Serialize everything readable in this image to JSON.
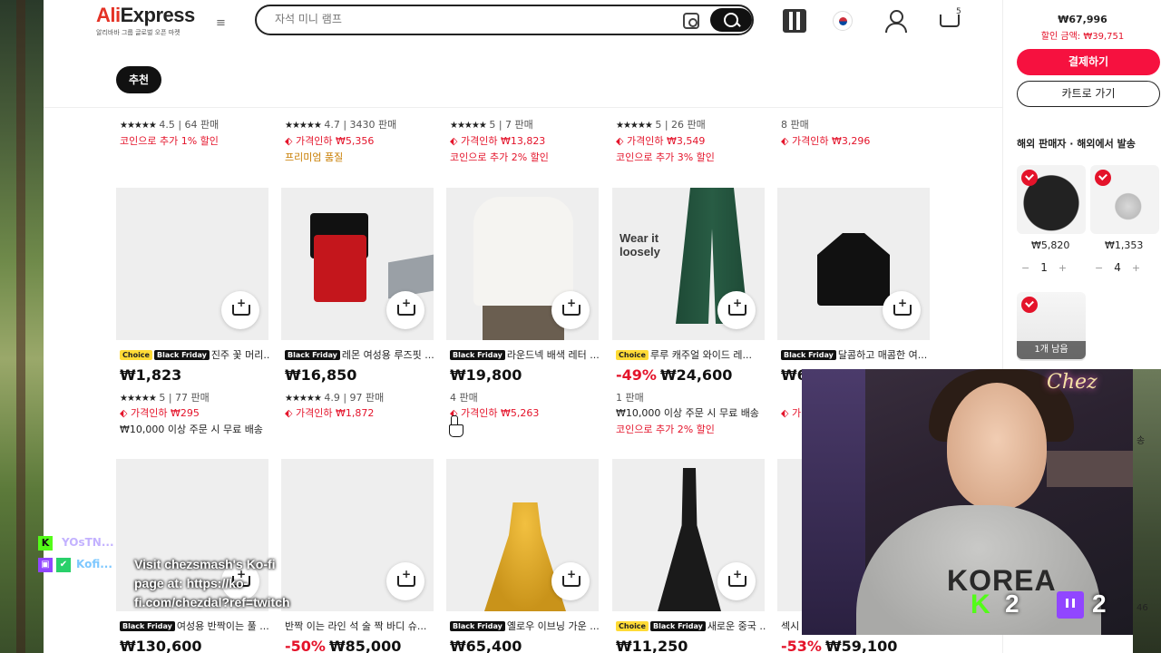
{
  "header": {
    "logo": "AliExpress",
    "logo_ali": "Ali",
    "logo_express": "Express",
    "logo_sub": "알리바바 그룹 글로벌 오픈 마켓",
    "search_placeholder": "자석 미니 램프",
    "cart_count": "5",
    "tab": "추천"
  },
  "top_row": [
    {
      "rating": "4.5",
      "sold": "64 판매",
      "l1": "코인으로 추가 1% 할인",
      "l2": ""
    },
    {
      "rating": "4.7",
      "sold": "3430 판매",
      "l1": "가격인하 ₩5,356",
      "l2": "프리미엄 품질"
    },
    {
      "rating": "5",
      "sold": "7 판매",
      "l1": "가격인하 ₩13,823",
      "l2": "코인으로 추가 2% 할인"
    },
    {
      "rating": "5",
      "sold": "26 판매",
      "l1": "가격인하 ₩3,549",
      "l2": "코인으로 추가 3% 할인"
    },
    {
      "rating": "",
      "sold": "8 판매",
      "l1": "가격인하 ₩3,296",
      "l2": ""
    }
  ],
  "products": [
    {
      "title": "진주 꽃 머리...",
      "badges": [
        "Choice",
        "Black Friday"
      ],
      "discount": "",
      "price": "₩1,823",
      "rating": "5",
      "sold": "77 판매",
      "cut": "가격인하 ₩295",
      "extra": "₩10,000 이상 주문 시 무료 배송"
    },
    {
      "title": "레몬 여성용 루즈핏 ...",
      "badges": [
        "Black Friday"
      ],
      "discount": "",
      "price": "₩16,850",
      "rating": "4.9",
      "sold": "97 판매",
      "cut": "가격인하 ₩1,872",
      "extra": ""
    },
    {
      "title": "라운드넥 배색 레터 ...",
      "badges": [
        "Black Friday"
      ],
      "discount": "",
      "price": "₩19,800",
      "rating": "",
      "sold": "4 판매",
      "cut": "가격인하 ₩5,263",
      "extra": ""
    },
    {
      "title": "루루 캐주얼 와이드 레...",
      "badges": [
        "Choice",
        "Black Friday"
      ],
      "discount": "-49%",
      "price": "₩24,600",
      "rating": "",
      "sold": "1 판매",
      "cut": "₩10,000 이상 주문 시 무료 배송",
      "extra": "코인으로 추가 2% 할인",
      "pants_text": "Wear it loosely"
    },
    {
      "title": "달콤하고 매콤한 여...",
      "badges": [
        "Black Friday"
      ],
      "discount": "",
      "price": "₩6",
      "rating": "",
      "sold": "",
      "cut": "가",
      "extra": ""
    }
  ],
  "bottom_row": [
    {
      "title": "여성용 반짝이는 풀 ...",
      "badges": [
        "Black Friday"
      ],
      "discount": "",
      "price": "₩130,600"
    },
    {
      "title": "반짝 이는 라인 석 술 짝 바디 슈...",
      "badges": [],
      "discount": "-50%",
      "price": "₩85,000"
    },
    {
      "title": "옐로우 이브닝 가운 ...",
      "badges": [
        "Black Friday"
      ],
      "discount": "",
      "price": "₩65,400"
    },
    {
      "title": "새로운 중국 ...",
      "badges": [
        "Choice",
        "Black Friday"
      ],
      "discount": "",
      "price": "₩11,250"
    },
    {
      "title": "섹시",
      "badges": [],
      "discount": "-53%",
      "price": "₩59,100"
    }
  ],
  "cart_panel": {
    "total": "₩67,996",
    "discount": "할인 금액: ₩39,751",
    "checkout": "결제하기",
    "go_cart": "카트로 가기",
    "section": "해외 판매자 · 해외에서 발송",
    "items": [
      {
        "price": "₩5,820",
        "qty": "1"
      },
      {
        "price": "₩1,353",
        "qty": "4"
      }
    ],
    "remaining": "1개 남음",
    "minus": "−",
    "plus": "+"
  },
  "stream": {
    "chat_user1": "YOsTN...",
    "chat_user2": "Kofi...",
    "kofi_message": "Visit chezsmash's Ko-fi page at: https://ko-fi.com/chezdal?ref=twitch",
    "cam_sign": "Chez",
    "hoodie_text": "KOREA",
    "kick_count": "2",
    "twitch_count": "2",
    "side_text_1": "송",
    "side_text_2": "46"
  },
  "colors": {
    "accent": "#f6113f",
    "price_red": "#e4132a",
    "choice_yellow": "#ffdb36"
  }
}
